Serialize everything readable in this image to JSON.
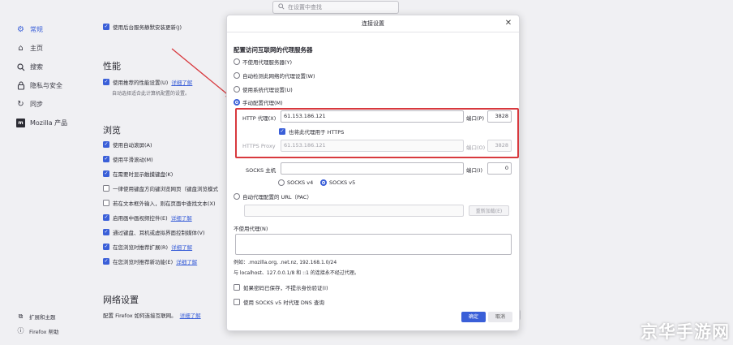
{
  "search": {
    "placeholder": "在设置中查找"
  },
  "sidebar": {
    "items": [
      {
        "label": "常规",
        "icon": "gear-icon"
      },
      {
        "label": "主页",
        "icon": "home-icon"
      },
      {
        "label": "搜索",
        "icon": "search-icon"
      },
      {
        "label": "隐私与安全",
        "icon": "lock-icon"
      },
      {
        "label": "同步",
        "icon": "sync-icon"
      },
      {
        "label": "Mozilla 产品",
        "icon": "mozilla-icon"
      }
    ],
    "bottom": [
      {
        "label": "扩展和主题",
        "icon": "puzzle-icon"
      },
      {
        "label": "Firefox 帮助",
        "icon": "help-icon"
      }
    ]
  },
  "background": {
    "top_row": "使用后台服务静默安装更新(J)",
    "performance": {
      "heading": "性能",
      "row": "使用推荐的性能设置(U)",
      "link": "详细了解",
      "sub": "自动选择适合此计算机配置的设置。"
    },
    "browsing": {
      "heading": "浏览",
      "rows": [
        {
          "text": "使用自动滚屏(A)",
          "checked": true,
          "link": ""
        },
        {
          "text": "使用平滑滚动(M)",
          "checked": true,
          "link": ""
        },
        {
          "text": "在需要时显示触摸键盘(K)",
          "checked": true,
          "link": ""
        },
        {
          "text": "一律使用键盘方向键浏览网页（键盘浏览模式",
          "checked": false,
          "link": ""
        },
        {
          "text": "若在文本框外输入，则在页面中查找文本(X)",
          "checked": false,
          "link": ""
        },
        {
          "text": "启用画中画视频控件(E)",
          "checked": true,
          "link": "详细了解"
        },
        {
          "text": "通过键盘、耳机或虚拟界面控制媒体(V)",
          "checked": true,
          "link": ""
        },
        {
          "text": "在您浏览时推荐扩展(R)",
          "checked": true,
          "link": "详细了解"
        },
        {
          "text": "在您浏览时推荐新功能(E)",
          "checked": true,
          "link": "详细了解"
        }
      ]
    },
    "network": {
      "heading": "网络设置",
      "row": "配置 Firefox 如何连接互联网。",
      "link": "详细了解"
    }
  },
  "dialog": {
    "title": "连接设置",
    "heading": "配置访问互联网的代理服务器",
    "options": [
      {
        "label": "不使用代理服务器(Y)",
        "selected": false
      },
      {
        "label": "自动检测此网络的代理设置(W)",
        "selected": false
      },
      {
        "label": "使用系统代理设置(U)",
        "selected": false
      },
      {
        "label": "手动配置代理(M)",
        "selected": true
      }
    ],
    "http": {
      "label": "HTTP 代理(X)",
      "value": "61.153.186.121",
      "port_label": "端口(P)",
      "port": "3828"
    },
    "https_checkbox": "也将此代理用于 HTTPS",
    "https": {
      "label": "HTTPS Proxy",
      "value": "61.153.186.121",
      "port_label": "端口(O)",
      "port": "3828"
    },
    "socks": {
      "label": "SOCKS 主机",
      "value": "",
      "port_label": "端口(I)",
      "port": "0"
    },
    "socks_v4": "SOCKS v4",
    "socks_v5": "SOCKS v5",
    "pac": {
      "label": "自动代理配置的 URL（PAC）",
      "value": "",
      "reload": "重新加载(E)"
    },
    "no_proxy_label": "不使用代理(N)",
    "no_proxy_value": "",
    "example": "例如：.mozilla.org, .net.nz, 192.168.1.0/24",
    "localhost_note": "与 localhost、127.0.0.1/8 和 ::1 的连接永不经过代理。",
    "no_auth": "如果密码已保存，不提示身份验证(I)",
    "socks_dns": "使用 SOCKS v5 时代理 DNS 查询",
    "ok": "确定",
    "cancel": "取消"
  },
  "watermark": "京华手游网",
  "colors": {
    "accent": "#3a5fd8",
    "highlight": "#d8393e"
  }
}
